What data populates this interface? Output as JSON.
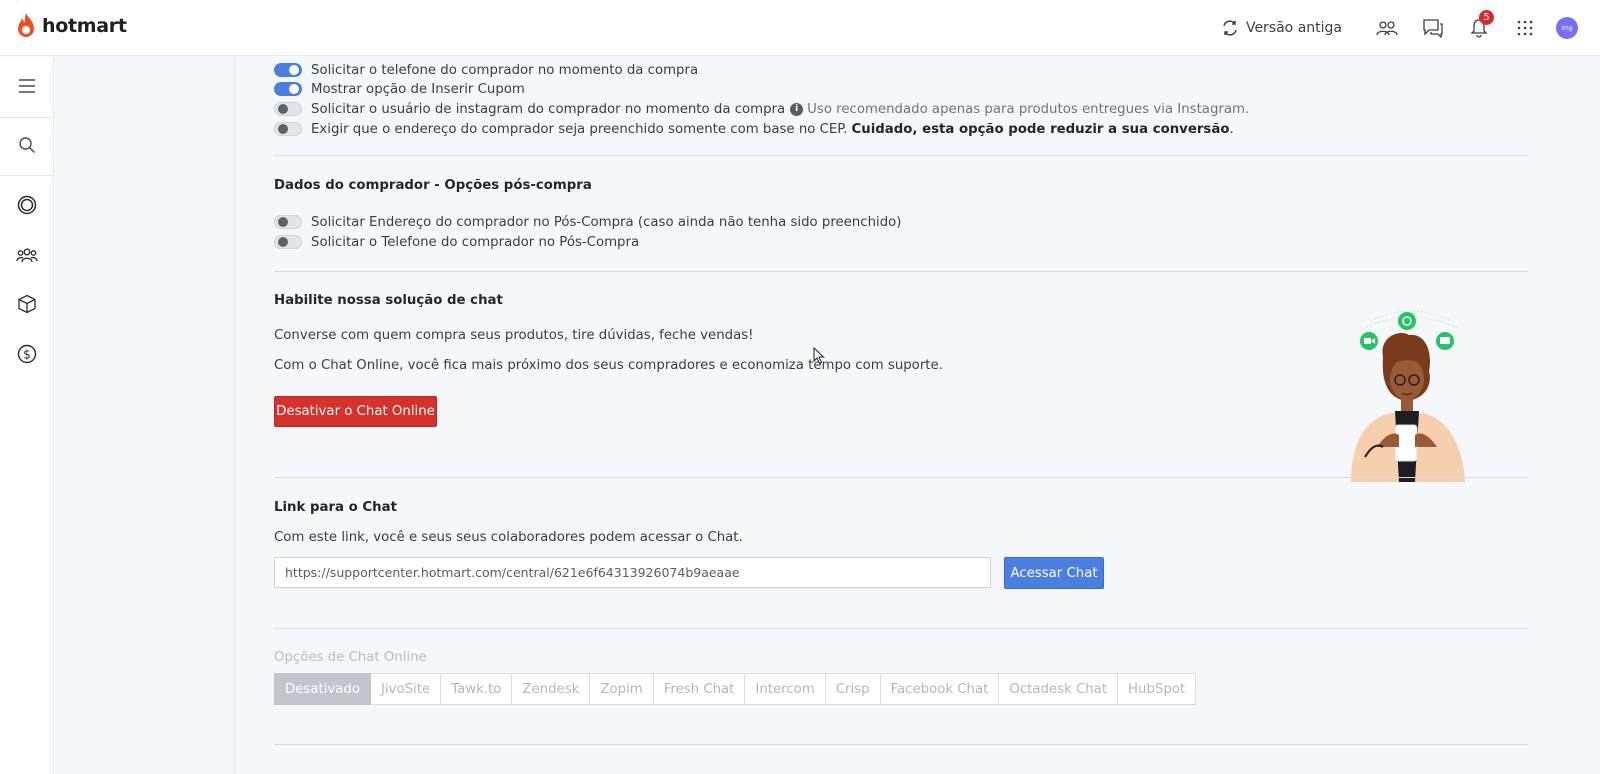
{
  "header": {
    "brand": "hotmart",
    "old_version_label": "Versão antiga",
    "notifications_count": "5",
    "avatar_text": "img"
  },
  "sidebar": {
    "items": [
      "menu-icon",
      "search-icon",
      "target-icon",
      "users-icon",
      "box-icon",
      "dollar-icon"
    ]
  },
  "checkout_options": {
    "toggles": [
      {
        "label": "Solicitar o telefone do comprador no momento da compra",
        "on": true
      },
      {
        "label": "Mostrar opção de Inserir Cupom",
        "on": true
      },
      {
        "label": "Solicitar o usuário de instagram do comprador no momento da compra",
        "note": "Uso recomendado apenas para produtos entregues via Instagram.",
        "on": false
      },
      {
        "label": "Exigir que o endereço do comprador seja preenchido somente com base no CEP.",
        "warning": "Cuidado, esta opção pode reduzir a sua conversão",
        "warning_suffix": ".",
        "on": false
      }
    ]
  },
  "post_purchase": {
    "title": "Dados do comprador - Opções pós-compra",
    "toggles": [
      {
        "label": "Solicitar Endereço do comprador no Pós-Compra (caso ainda não tenha sido preenchido)",
        "on": false
      },
      {
        "label": "Solicitar o Telefone do comprador no Pós-Compra",
        "on": false
      }
    ]
  },
  "chat": {
    "title": "Habilite nossa solução de chat",
    "line1": "Converse com quem compra seus produtos, tire dúvidas, feche vendas!",
    "line2": "Com o Chat Online, você fica mais próximo dos seus compradores e economiza tempo com suporte.",
    "disable_button": "Desativar o Chat Online"
  },
  "chat_link": {
    "title": "Link para o Chat",
    "description": "Com este link, você e seus seus colaboradores podem acessar o Chat.",
    "url": "https://supportcenter.hotmart.com/central/621e6f64313926074b9aeaae",
    "access_button": "Acessar Chat"
  },
  "chat_options": {
    "label": "Opções de Chat Online",
    "items": [
      "Desativado",
      "JivoSite",
      "Tawk.to",
      "Zendesk",
      "Zopim",
      "Fresh Chat",
      "Intercom",
      "Crisp",
      "Facebook Chat",
      "Octadesk Chat",
      "HubSpot"
    ],
    "selected": "Desativado"
  },
  "colors": {
    "brand_orange": "#f04e23",
    "toggle_on": "#4a7ee0",
    "danger": "#d6312b",
    "primary": "#4a7ee0"
  }
}
